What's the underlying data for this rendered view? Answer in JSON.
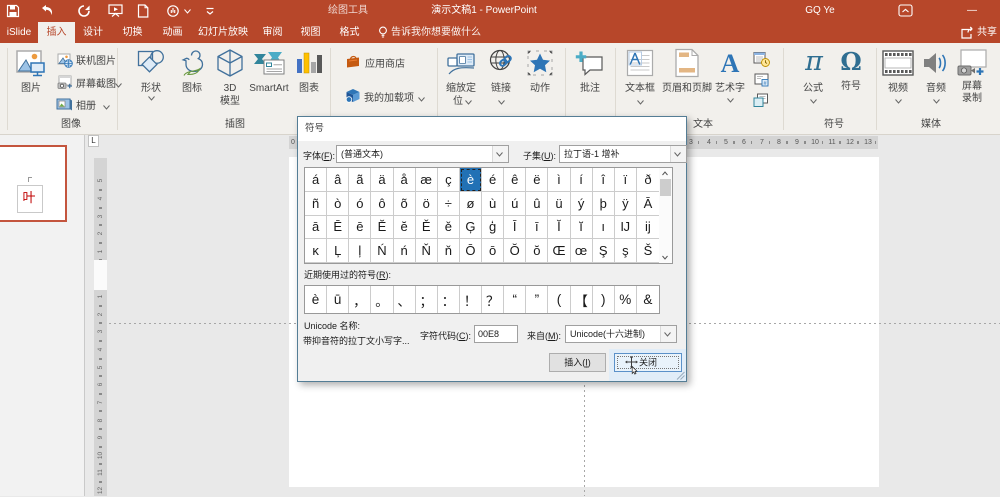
{
  "titlebar": {
    "qat_icons": [
      "save-icon",
      "undo-icon",
      "redo-icon",
      "start-slideshow-icon",
      "new-file-icon",
      "touch-mode-icon",
      "customize-qat-icon"
    ],
    "context_title": "绘图工具",
    "title": "演示文稿1 - PowerPoint",
    "user": "GQ Ye",
    "minimize": "—"
  },
  "tabs": {
    "items": [
      {
        "label": "iSlide"
      },
      {
        "label": "插入"
      },
      {
        "label": "设计"
      },
      {
        "label": "切换"
      },
      {
        "label": "动画"
      },
      {
        "label": "幻灯片放映"
      },
      {
        "label": "审阅"
      },
      {
        "label": "视图"
      },
      {
        "label": "格式"
      }
    ],
    "active": "插入",
    "tellme": "告诉我你想要做什么",
    "share": "共享"
  },
  "ribbon": {
    "images_group": {
      "label": "图像",
      "picture": "图片",
      "online": "联机图片",
      "screenshot": "屏幕截图",
      "album": "相册"
    },
    "illustrations_group": {
      "label": "插图",
      "shapes": "形状",
      "icons": "图标",
      "model3d_1": "3D",
      "model3d_2": "模型",
      "smartart": "SmartArt",
      "chart": "图表"
    },
    "addins_group": {
      "store": "应用商店",
      "myaddins": "我的加载项"
    },
    "links_group": {
      "zoom1": "缩放定",
      "zoom2": "位",
      "link": "链接",
      "action": "动作"
    },
    "comment_group": {
      "comment": "批注"
    },
    "text_group": {
      "label": "文本",
      "textbox": "文本框",
      "headerfooter": "页眉和页脚",
      "wordart": "艺术字"
    },
    "symbols_group": {
      "label": "符号",
      "equation": "公式",
      "symbol": "符号"
    },
    "media_group": {
      "label": "媒体",
      "video": "视频",
      "audio": "音频",
      "screenrec1": "屏幕",
      "screenrec2": "录制"
    }
  },
  "rulers": {
    "h_numbers": [
      "0",
      "3",
      "4",
      "5",
      "6",
      "7",
      "8",
      "9",
      "10",
      "11",
      "12",
      "13"
    ],
    "v_above": [
      "5",
      "4",
      "3",
      "2",
      "1"
    ],
    "v_below": [
      "1",
      "2",
      "3",
      "4",
      "5",
      "6",
      "7",
      "8",
      "9",
      "10",
      "11",
      "12"
    ],
    "tab_selector": "L"
  },
  "thumbnail": {
    "char": "叶"
  },
  "dialog": {
    "title": "符号",
    "font_label": "字体(F):",
    "font_value": "(普通文本)",
    "subset_label": "子集(U):",
    "subset_value": "拉丁语-1 增补",
    "grid_rows": [
      [
        "á",
        "â",
        "ã",
        "ä",
        "å",
        "æ",
        "ç",
        "è",
        "é",
        "ê",
        "ë",
        "ì",
        "í",
        "î",
        "ï",
        "ð"
      ],
      [
        "ñ",
        "ò",
        "ó",
        "ô",
        "õ",
        "ö",
        "÷",
        "ø",
        "ù",
        "ú",
        "û",
        "ü",
        "ý",
        "þ",
        "ÿ",
        "Ā"
      ],
      [
        "ā",
        "Ē",
        "ē",
        "Ĕ",
        "ĕ",
        "Ě",
        "ě",
        "Ģ",
        "ģ",
        "Ī",
        "ī",
        "Ĭ",
        "ĭ",
        "ı",
        "Ĳ",
        "ĳ"
      ],
      [
        "ĸ",
        "Ļ",
        "ļ",
        "Ń",
        "ń",
        "Ň",
        "ň",
        "Ō",
        "ō",
        "Ŏ",
        "ŏ",
        "Œ",
        "œ",
        "Ş",
        "ş",
        "Š"
      ]
    ],
    "selected_cell": {
      "row": 0,
      "col": 7,
      "char": "è"
    },
    "recent_label": "近期使用过的符号(R):",
    "recent": [
      "è",
      "ū",
      "，",
      "。",
      "、",
      "；",
      "：",
      "！",
      "？",
      "“",
      "”",
      "(",
      "【",
      ")",
      "%",
      "&"
    ],
    "unicode_label": "Unicode 名称:",
    "unicode_name": "带抑音符的拉丁文小写字...",
    "charcode_label": "字符代码(C):",
    "charcode_value": "00E8",
    "from_label": "来自(M):",
    "from_value": "Unicode(十六进制)",
    "insert_button": "插入(I)",
    "close_button": "关闭"
  }
}
